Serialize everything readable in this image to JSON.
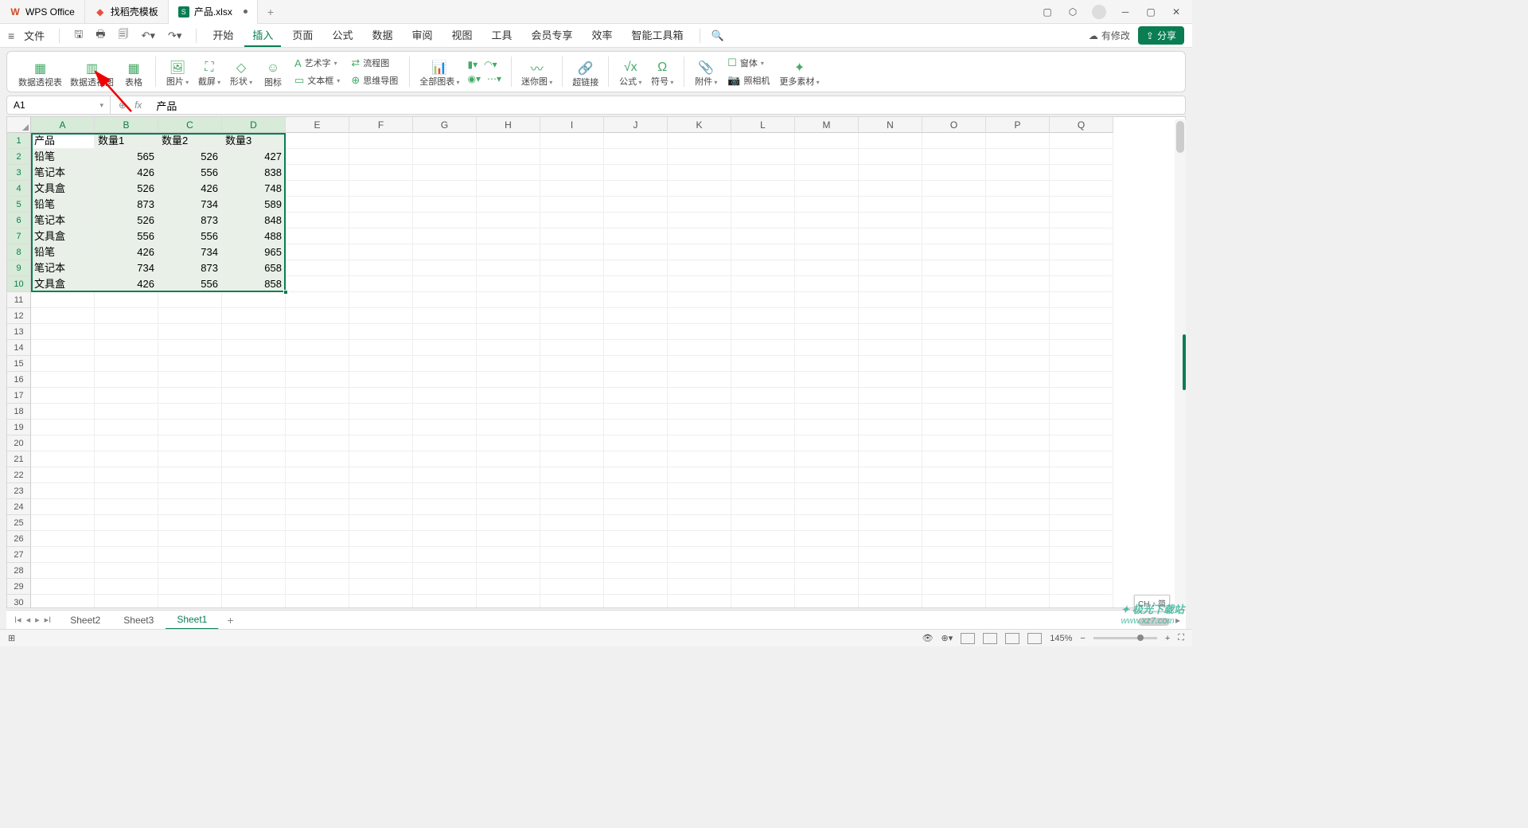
{
  "titlebar": {
    "tabs": [
      {
        "icon": "W",
        "iconColor": "#d24726",
        "label": "WPS Office"
      },
      {
        "icon": "◆",
        "iconColor": "#e84e40",
        "label": "找稻壳模板"
      },
      {
        "icon": "S",
        "iconColor": "#0a7d52",
        "label": "产品.xlsx",
        "active": true,
        "modified": true
      }
    ]
  },
  "menubar": {
    "file": "文件",
    "items": [
      "开始",
      "插入",
      "页面",
      "公式",
      "数据",
      "审阅",
      "视图",
      "工具",
      "会员专享",
      "效率",
      "智能工具箱"
    ],
    "activeIndex": 1,
    "cloud": "有修改",
    "share": "分享"
  },
  "ribbon": {
    "g1": [
      {
        "label": "数据透视表"
      },
      {
        "label": "数据透视图"
      },
      {
        "label": "表格"
      }
    ],
    "g2": [
      {
        "label": "图片",
        "dd": true
      },
      {
        "label": "截屏",
        "dd": true
      },
      {
        "label": "形状",
        "dd": true
      },
      {
        "label": "图标"
      }
    ],
    "g2stack": [
      {
        "label": "艺术字",
        "dd": true
      },
      {
        "label": "文本框",
        "dd": true
      }
    ],
    "g2stack2": [
      {
        "label": "流程图"
      },
      {
        "label": "思维导图"
      }
    ],
    "g3": [
      {
        "label": "全部图表",
        "dd": true
      }
    ],
    "g4": [
      {
        "label": "迷你图",
        "dd": true
      }
    ],
    "g5": [
      {
        "label": "超链接"
      }
    ],
    "g6": [
      {
        "label": "公式",
        "dd": true
      },
      {
        "label": "符号",
        "dd": true
      }
    ],
    "g7": [
      {
        "label": "附件",
        "dd": true
      }
    ],
    "g7stack": [
      {
        "label": "窗体",
        "dd": true
      },
      {
        "label": "照相机"
      }
    ],
    "g8": [
      {
        "label": "更多素材",
        "dd": true
      }
    ]
  },
  "formula": {
    "cellRef": "A1",
    "content": "产品"
  },
  "columns": [
    "A",
    "B",
    "C",
    "D",
    "E",
    "F",
    "G",
    "H",
    "I",
    "J",
    "K",
    "L",
    "M",
    "N",
    "O",
    "P",
    "Q"
  ],
  "rows": 30,
  "data": {
    "headers": [
      "产品",
      "数量1",
      "数量2",
      "数量3"
    ],
    "rows": [
      [
        "铅笔",
        565,
        526,
        427
      ],
      [
        "笔记本",
        426,
        556,
        838
      ],
      [
        "文具盒",
        526,
        426,
        748
      ],
      [
        "铅笔",
        873,
        734,
        589
      ],
      [
        "笔记本",
        526,
        873,
        848
      ],
      [
        "文具盒",
        556,
        556,
        488
      ],
      [
        "铅笔",
        426,
        734,
        965
      ],
      [
        "笔记本",
        734,
        873,
        658
      ],
      [
        "文具盒",
        426,
        556,
        858
      ]
    ]
  },
  "sheets": {
    "tabs": [
      "Sheet2",
      "Sheet3",
      "Sheet1"
    ],
    "activeIndex": 2
  },
  "status": {
    "ime": "CH ♪ 简",
    "zoom": "145%"
  },
  "watermark": {
    "name": "极光下载站",
    "url": "www.xz7.com"
  }
}
